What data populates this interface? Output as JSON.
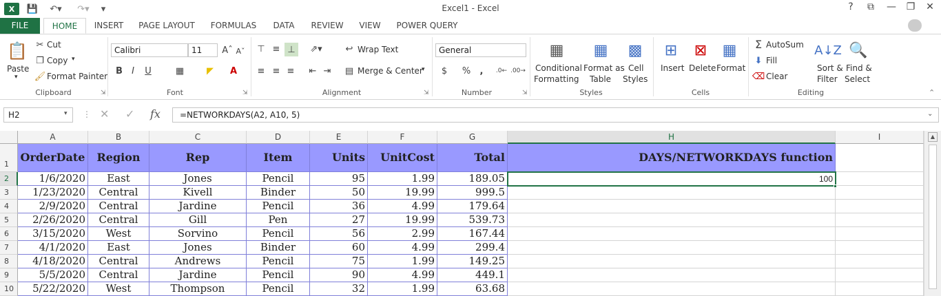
{
  "title_bar": {
    "title": "Excel1 - Excel",
    "help": "?",
    "minimize": "—",
    "restore": "❐",
    "close": "✕"
  },
  "tabs": [
    "FILE",
    "HOME",
    "INSERT",
    "PAGE LAYOUT",
    "FORMULAS",
    "DATA",
    "REVIEW",
    "VIEW",
    "POWER QUERY"
  ],
  "ribbon": {
    "clipboard": {
      "paste": "Paste",
      "cut": "Cut",
      "copy": "Copy",
      "format_painter": "Format Painter",
      "label": "Clipboard"
    },
    "font": {
      "name": "Calibri",
      "size": "11",
      "bold": "B",
      "italic": "I",
      "underline": "U",
      "label": "Font"
    },
    "alignment": {
      "wrap_text": "Wrap Text",
      "merge_center": "Merge & Center",
      "label": "Alignment"
    },
    "number": {
      "format": "General",
      "currency": "$",
      "percent": "%",
      "comma": ",",
      "label": "Number"
    },
    "styles": {
      "conditional": "Conditional",
      "conditional2": "Formatting",
      "format_as": "Format as",
      "format_as2": "Table",
      "cell": "Cell",
      "cell2": "Styles",
      "label": "Styles"
    },
    "cells": {
      "insert": "Insert",
      "delete": "Delete",
      "format": "Format",
      "label": "Cells"
    },
    "editing": {
      "autosum": "AutoSum",
      "fill": "Fill",
      "clear": "Clear",
      "sort": "Sort &",
      "sort2": "Filter",
      "find": "Find &",
      "find2": "Select",
      "label": "Editing"
    }
  },
  "formula_bar": {
    "name_box": "H2",
    "fx": "fx",
    "formula": "=NETWORKDAYS(A2, A10, 5)"
  },
  "columns": [
    "A",
    "B",
    "C",
    "D",
    "E",
    "F",
    "G",
    "H",
    "I"
  ],
  "rows": [
    "1",
    "2",
    "3",
    "4",
    "5",
    "6",
    "7",
    "8",
    "9",
    "10"
  ],
  "headers": [
    "OrderDate",
    "Region",
    "Rep",
    "Item",
    "Units",
    "UnitCost",
    "Total",
    "DAYS/NETWORKDAYS function"
  ],
  "data_rows": [
    [
      "1/6/2020",
      "East",
      "Jones",
      "Pencil",
      "95",
      "1.99",
      "189.05"
    ],
    [
      "1/23/2020",
      "Central",
      "Kivell",
      "Binder",
      "50",
      "19.99",
      "999.5"
    ],
    [
      "2/9/2020",
      "Central",
      "Jardine",
      "Pencil",
      "36",
      "4.99",
      "179.64"
    ],
    [
      "2/26/2020",
      "Central",
      "Gill",
      "Pen",
      "27",
      "19.99",
      "539.73"
    ],
    [
      "3/15/2020",
      "West",
      "Sorvino",
      "Pencil",
      "56",
      "2.99",
      "167.44"
    ],
    [
      "4/1/2020",
      "East",
      "Jones",
      "Binder",
      "60",
      "4.99",
      "299.4"
    ],
    [
      "4/18/2020",
      "Central",
      "Andrews",
      "Pencil",
      "75",
      "1.99",
      "149.25"
    ],
    [
      "5/5/2020",
      "Central",
      "Jardine",
      "Pencil",
      "90",
      "4.99",
      "449.1"
    ],
    [
      "5/22/2020",
      "West",
      "Thompson",
      "Pencil",
      "32",
      "1.99",
      "63.68"
    ]
  ],
  "h2_value": "100",
  "colors": {
    "accent": "#217346",
    "header_fill": "#9999ff"
  }
}
